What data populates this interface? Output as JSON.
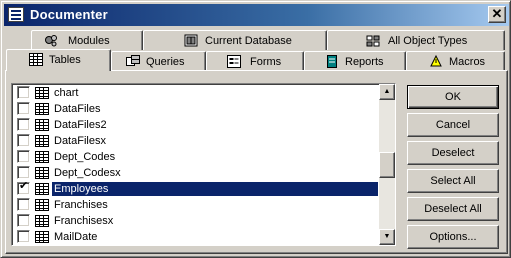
{
  "window": {
    "title": "Documenter",
    "close_glyph": "✕"
  },
  "tabs_back": [
    {
      "label": "Modules",
      "icon": "modules-icon"
    },
    {
      "label": "Current Database",
      "icon": "current-database-icon"
    },
    {
      "label": "All Object Types",
      "icon": "all-object-types-icon"
    }
  ],
  "tabs_front": [
    {
      "label": "Tables",
      "icon": "table-icon",
      "active": true
    },
    {
      "label": "Queries",
      "icon": "query-icon"
    },
    {
      "label": "Forms",
      "icon": "form-icon"
    },
    {
      "label": "Reports",
      "icon": "report-icon"
    },
    {
      "label": "Macros",
      "icon": "macro-icon"
    }
  ],
  "list": {
    "items": [
      {
        "label": "chart",
        "checked": false,
        "selected": false
      },
      {
        "label": "DataFiles",
        "checked": false,
        "selected": false
      },
      {
        "label": "DataFiles2",
        "checked": false,
        "selected": false
      },
      {
        "label": "DataFilesx",
        "checked": false,
        "selected": false
      },
      {
        "label": "Dept_Codes",
        "checked": false,
        "selected": false
      },
      {
        "label": "Dept_Codesx",
        "checked": false,
        "selected": false
      },
      {
        "label": "Employees",
        "checked": true,
        "selected": true
      },
      {
        "label": "Franchises",
        "checked": false,
        "selected": false
      },
      {
        "label": "Franchisesx",
        "checked": false,
        "selected": false
      },
      {
        "label": "MailDate",
        "checked": false,
        "selected": false
      }
    ],
    "check_glyph": "✔"
  },
  "buttons": {
    "ok": "OK",
    "cancel": "Cancel",
    "deselect": "Deselect",
    "select_all": "Select All",
    "deselect_all": "Deselect All",
    "options": "Options..."
  },
  "scrollbar": {
    "up_glyph": "▲",
    "down_glyph": "▼"
  }
}
